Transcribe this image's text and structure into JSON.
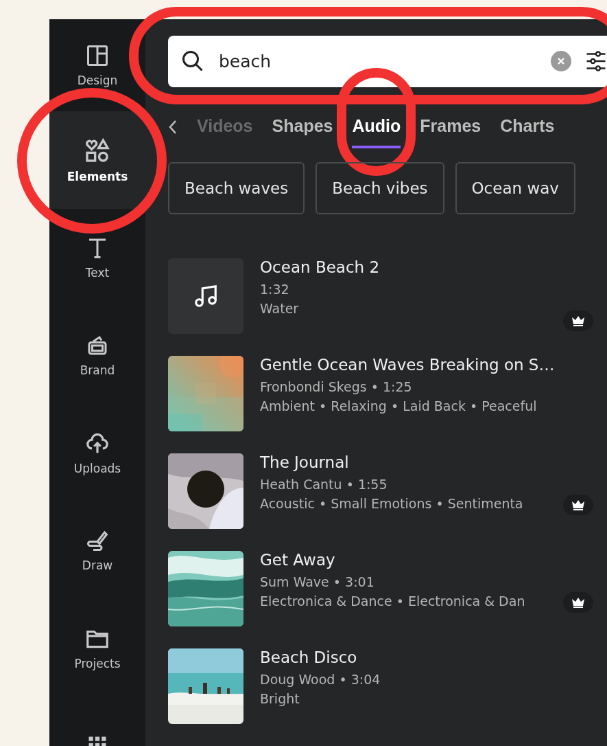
{
  "sidebar": {
    "items": [
      {
        "label": "Design",
        "selected": false
      },
      {
        "label": "Elements",
        "selected": true
      },
      {
        "label": "Text",
        "selected": false
      },
      {
        "label": "Brand",
        "selected": false
      },
      {
        "label": "Uploads",
        "selected": false
      },
      {
        "label": "Draw",
        "selected": false
      },
      {
        "label": "Projects",
        "selected": false
      },
      {
        "selected": false
      }
    ]
  },
  "search": {
    "value": "beach"
  },
  "tabs": [
    {
      "label": "Videos",
      "selected": false
    },
    {
      "label": "Shapes",
      "selected": false
    },
    {
      "label": "Audio",
      "selected": true
    },
    {
      "label": "Frames",
      "selected": false
    },
    {
      "label": "Charts",
      "selected": false
    }
  ],
  "suggestions": [
    "Beach waves",
    "Beach vibes",
    "Ocean wav"
  ],
  "tracks": [
    {
      "kind": "icon",
      "title": "Ocean Beach 2",
      "meta": "1:32",
      "tags": "Water",
      "premium": true
    },
    {
      "kind": "picture",
      "title": "Gentle Ocean Waves Breaking on S…",
      "meta": "Fronbondi Skegs • 1:25",
      "tags": "Ambient • Relaxing • Laid Back • Peaceful",
      "premium": false
    },
    {
      "kind": "picture",
      "title": "The Journal",
      "meta": "Heath Cantu • 1:55",
      "tags": "Acoustic • Small Emotions • Sentimenta",
      "premium": true
    },
    {
      "kind": "picture",
      "title": "Get Away",
      "meta": "Sum Wave • 3:01",
      "tags": "Electronica & Dance • Electronica & Dan",
      "premium": true
    },
    {
      "kind": "picture",
      "title": "Beach Disco",
      "meta": "Doug Wood • 3:04",
      "tags": "Bright",
      "premium": false
    }
  ]
}
